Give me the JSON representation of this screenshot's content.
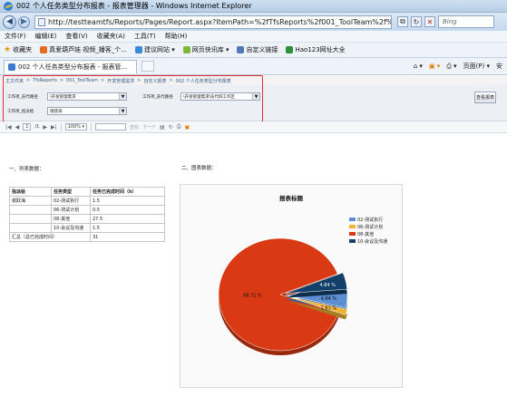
{
  "window": {
    "title": "002 个人任务类型分布报表 - 报表管理器 - Windows Internet Explorer"
  },
  "address": {
    "url": "http://testteamtfs/Reports/Pages/Report.aspx?ItemPath=%2fTfsReports%2f001_ToolTeam%2f%e5%8f",
    "search_placeholder": "Bing"
  },
  "menu": [
    "文件(F)",
    "编辑(E)",
    "查看(V)",
    "收藏夹(A)",
    "工具(T)",
    "帮助(H)"
  ],
  "favorites": {
    "favorites_label": "收藏夹",
    "items": [
      "真爱葫芦娃 视频_播客_个...",
      "建议网站 ▾",
      "网页快讯库 ▾",
      "自定义链接",
      "Hao123网址大全"
    ]
  },
  "tab": {
    "title": "002 个人任务类型分布报表 - 报表管..."
  },
  "commands": {
    "page": "页面(P) ▾",
    "safety": "安"
  },
  "breadcrumb": [
    "主文件夹",
    "TfsReports",
    "001_ToolTeam",
    "开发管理需求",
    "自定义报表",
    "002 个人任务类型分布报表"
  ],
  "params": {
    "p1_label": "工作项_迭代路径",
    "p1_value": "\\开发管理需求",
    "p2_label": "工作项_迭代路径",
    "p2_value": "\\开发管理需求\\迭代四工作区",
    "p3_label": "工作项_指派给",
    "p3_value": "谢跃海",
    "view_button": "查看报表"
  },
  "report_toolbar": {
    "page": "1",
    "of": "/1",
    "zoom": "100%",
    "find": "查找",
    "next": "下一个"
  },
  "content": {
    "section1_title": "一、列表数据：",
    "section2_title": "二、图表数据：",
    "table": {
      "headers": [
        "指派给",
        "任务类型",
        "任务已完成时间（h）"
      ],
      "person": "谢跃海",
      "rows": [
        {
          "type": "02-测试执行",
          "hours": "1.5"
        },
        {
          "type": "06-测试计划",
          "hours": "0.5"
        },
        {
          "type": "08-其他",
          "hours": "27.5"
        },
        {
          "type": "10-会议及沟通",
          "hours": "1.5"
        }
      ],
      "total_label": "汇总（总已完成时间）",
      "total_value": "31"
    }
  },
  "chart_data": {
    "type": "pie",
    "title": "报表标题",
    "legend_position": "right",
    "categories": [
      "02-测试执行",
      "06-测试计划",
      "08-其他",
      "10-会议及沟通"
    ],
    "values": [
      1.5,
      0.5,
      27.5,
      1.5
    ],
    "labels": [
      "4.84 %",
      "1.61 %",
      "88.71 %",
      "4.84 %"
    ],
    "colors": [
      "#5b8fd1",
      "#f0b234",
      "#d93a13",
      "#13406a"
    ]
  }
}
